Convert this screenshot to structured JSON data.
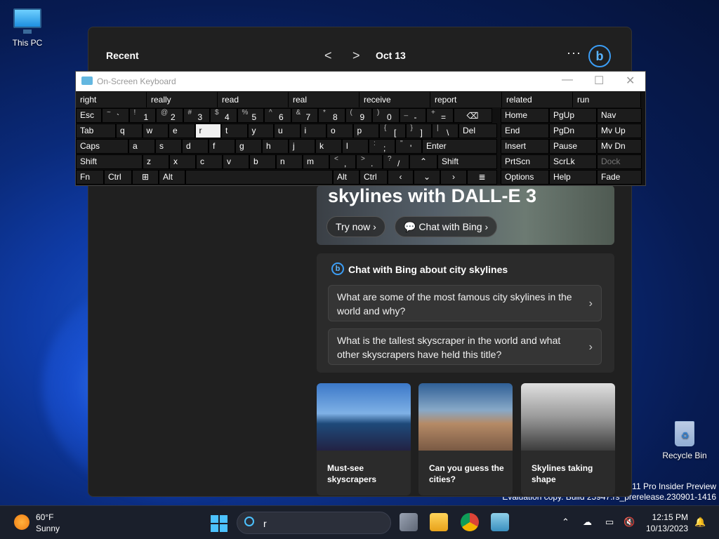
{
  "desktop": {
    "icons": [
      {
        "label": "This PC",
        "icon": "monitor-icon"
      },
      {
        "label": "Recycle Bin",
        "icon": "recycle-bin-icon"
      }
    ],
    "watermark": {
      "line1": "s 11 Pro Insider Preview",
      "line2": "Evaluation copy. Build 25947.rs_prerelease.230901-1416"
    }
  },
  "widgets": {
    "recent_label": "Recent",
    "prev": "<",
    "next": ">",
    "date": "Oct 13",
    "more": "···",
    "bing": "b",
    "hero": {
      "title": "skylines with DALL-E 3",
      "try_now": "Try now",
      "chat_with_bing": "Chat with Bing"
    },
    "chat_card": {
      "title": "Chat with Bing about city skylines",
      "questions": [
        "What are some of the most famous city skylines in the world and why?",
        "What is the tallest skyscraper in the world and what other skyscrapers have held this title?"
      ]
    },
    "tiles": [
      {
        "caption": "Must-see skyscrapers"
      },
      {
        "caption": "Can you guess the cities?"
      },
      {
        "caption": "Skylines taking shape"
      }
    ]
  },
  "osk": {
    "title": "On-Screen Keyboard",
    "suggestions": [
      "right",
      "really",
      "read",
      "real",
      "receive",
      "report",
      "related",
      "run"
    ],
    "row1": [
      {
        "s": "~",
        "m": "`"
      },
      {
        "s": "!",
        "m": "1"
      },
      {
        "s": "@",
        "m": "2"
      },
      {
        "s": "#",
        "m": "3"
      },
      {
        "s": "$",
        "m": "4"
      },
      {
        "s": "%",
        "m": "5"
      },
      {
        "s": "^",
        "m": "6"
      },
      {
        "s": "&",
        "m": "7"
      },
      {
        "s": "*",
        "m": "8"
      },
      {
        "s": "(",
        "m": "9"
      },
      {
        "s": ")",
        "m": "0"
      },
      {
        "s": "_",
        "m": "-"
      },
      {
        "s": "+",
        "m": "="
      }
    ],
    "row2": [
      "q",
      "w",
      "e",
      "r",
      "t",
      "y",
      "u",
      "i",
      "o",
      "p"
    ],
    "row2_brackets": [
      {
        "s": "{",
        "m": "["
      },
      {
        "s": "}",
        "m": "]"
      },
      {
        "s": "|",
        "m": "\\"
      }
    ],
    "row3": [
      "a",
      "s",
      "d",
      "f",
      "g",
      "h",
      "j",
      "k",
      "l"
    ],
    "row3_punct": [
      {
        "s": ":",
        "m": ";"
      },
      {
        "s": "\"",
        "m": "'"
      }
    ],
    "row4": [
      "z",
      "x",
      "c",
      "v",
      "b",
      "n",
      "m"
    ],
    "row4_punct": [
      {
        "s": "<",
        "m": ","
      },
      {
        "s": ">",
        "m": "."
      },
      {
        "s": "?",
        "m": "/"
      }
    ],
    "labels": {
      "esc": "Esc",
      "tab": "Tab",
      "caps": "Caps",
      "shift": "Shift",
      "fn": "Fn",
      "ctrl": "Ctrl",
      "alt": "Alt",
      "del": "Del",
      "enter": "Enter",
      "backspace": "⌫"
    },
    "nav": {
      "home": "Home",
      "pgup": "PgUp",
      "nav": "Nav",
      "end": "End",
      "pgdn": "PgDn",
      "mvup": "Mv Up",
      "insert": "Insert",
      "pause": "Pause",
      "mvdn": "Mv Dn",
      "prtscn": "PrtScn",
      "scrlk": "ScrLk",
      "dock": "Dock",
      "options": "Options",
      "help": "Help",
      "fade": "Fade"
    }
  },
  "taskbar": {
    "weather_temp": "60°F",
    "weather_cond": "Sunny",
    "search_value": "r",
    "time": "12:15 PM",
    "date": "10/13/2023"
  }
}
